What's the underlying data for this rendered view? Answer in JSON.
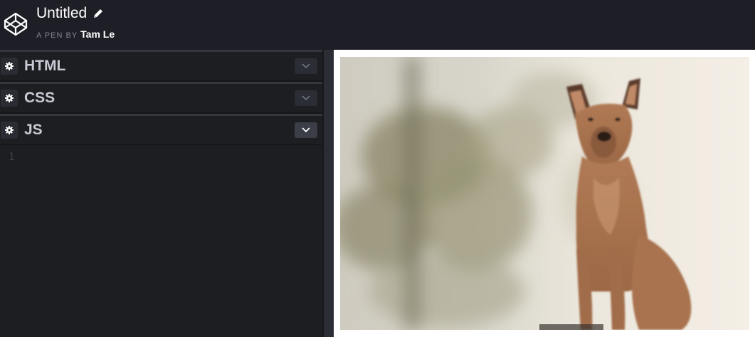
{
  "header": {
    "title": "Untitled",
    "byline_prefix": "A PEN BY",
    "author": "Tam Le"
  },
  "editors": [
    {
      "label": "HTML",
      "collapsed": true
    },
    {
      "label": "CSS",
      "collapsed": true
    },
    {
      "label": "JS",
      "collapsed": false,
      "line_numbers": [
        "1"
      ]
    }
  ],
  "preview": {
    "image": "dog-photo"
  },
  "colors": {
    "background": "#1e1f26",
    "editor_bar": "#1d1e22",
    "label": "#c7c9d3",
    "preview_bg": "#ffffff"
  }
}
